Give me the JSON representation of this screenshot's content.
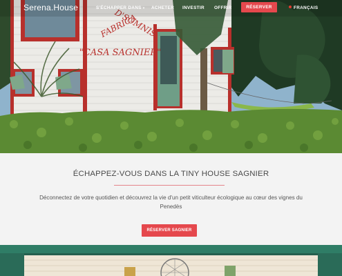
{
  "nav": {
    "brand": "Serena.House",
    "items": [
      {
        "label": "S'ÉCHAPPER DANS"
      },
      {
        "label": "ACHETER"
      },
      {
        "label": "INVESTIR"
      },
      {
        "label": "OFFRIR"
      }
    ],
    "cta": "RÉSERVER",
    "language": "FRANÇAIS"
  },
  "hero": {
    "sign_text": "FABRICA D'SOMNIS \"CASA SAGNIER\""
  },
  "section": {
    "title": "ÉCHAPPEZ-VOUS DANS LA TINY HOUSE SAGNIER",
    "description": "Déconnectez de votre quotidien et découvrez la vie d'un petit viticulteur écologique au cœur des vignes du Penedès",
    "button": "RÉSERVER SAGNIER"
  },
  "colors": {
    "accent": "#e5484d",
    "section_bg": "#f3f3f3"
  }
}
